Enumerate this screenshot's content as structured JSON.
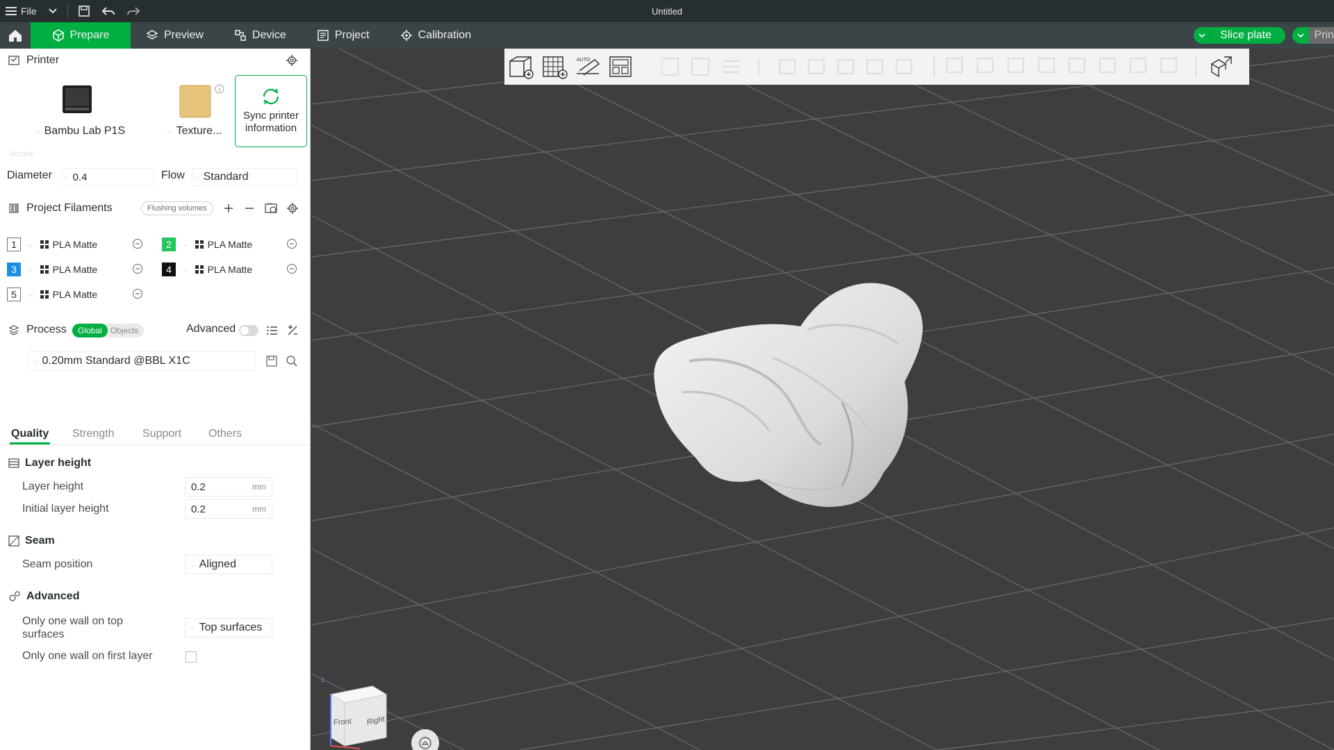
{
  "titlebar": {
    "file_label": "File",
    "title": "Untitled"
  },
  "tabs": {
    "prepare": "Prepare",
    "preview": "Preview",
    "device": "Device",
    "project": "Project",
    "calibration": "Calibration",
    "slice_plate": "Slice plate",
    "print_partial": "Prin"
  },
  "printer": {
    "section_title": "Printer",
    "printer_name": "Bambu Lab P1S",
    "plate_name": "Texture...",
    "sync_line1": "Sync printer",
    "sync_line2": "information",
    "nozzle_label": "Nozzle",
    "diameter_label": "Diameter",
    "diameter_value": "0.4",
    "flow_label": "Flow",
    "flow_value": "Standard"
  },
  "filaments": {
    "section_title": "Project Filaments",
    "flushing_label": "Flushing volumes",
    "items": [
      {
        "num": "1",
        "name": "PLA Matte",
        "color": "#ffffff",
        "num_color": "#262e30"
      },
      {
        "num": "2",
        "name": "PLA Matte",
        "color": "#22c55e",
        "num_color": "#ffffff"
      },
      {
        "num": "3",
        "name": "PLA Matte",
        "color": "#1e8fe0",
        "num_color": "#ffffff"
      },
      {
        "num": "4",
        "name": "PLA Matte",
        "color": "#111111",
        "num_color": "#ffffff"
      },
      {
        "num": "5",
        "name": "PLA Matte",
        "color": "#ffffff",
        "num_color": "#262e30"
      }
    ]
  },
  "process": {
    "section_title": "Process",
    "global_label": "Global",
    "objects_label": "Objects",
    "advanced_label": "Advanced",
    "preset": "0.20mm Standard @BBL X1C",
    "tabs": [
      "Quality",
      "Strength",
      "Support",
      "Others"
    ]
  },
  "quality": {
    "layer_height_group": "Layer height",
    "layer_height_label": "Layer height",
    "layer_height_value": "0.2",
    "initial_layer_label": "Initial layer height",
    "initial_layer_value": "0.2",
    "unit": "mm",
    "seam_group": "Seam",
    "seam_position_label": "Seam position",
    "seam_position_value": "Aligned",
    "advanced_group": "Advanced",
    "one_wall_top_label_1": "Only one wall on top",
    "one_wall_top_label_2": "surfaces",
    "one_wall_top_value": "Top surfaces",
    "one_wall_first_label": "Only one wall on first layer"
  },
  "viewcube": {
    "front": "Front",
    "right": "Right",
    "axis_z": "z"
  },
  "colors": {
    "accent": "#00ae42",
    "titlebar": "#262e30",
    "tabbar": "#3b4446",
    "viewport_bg": "#3e3e3e"
  }
}
